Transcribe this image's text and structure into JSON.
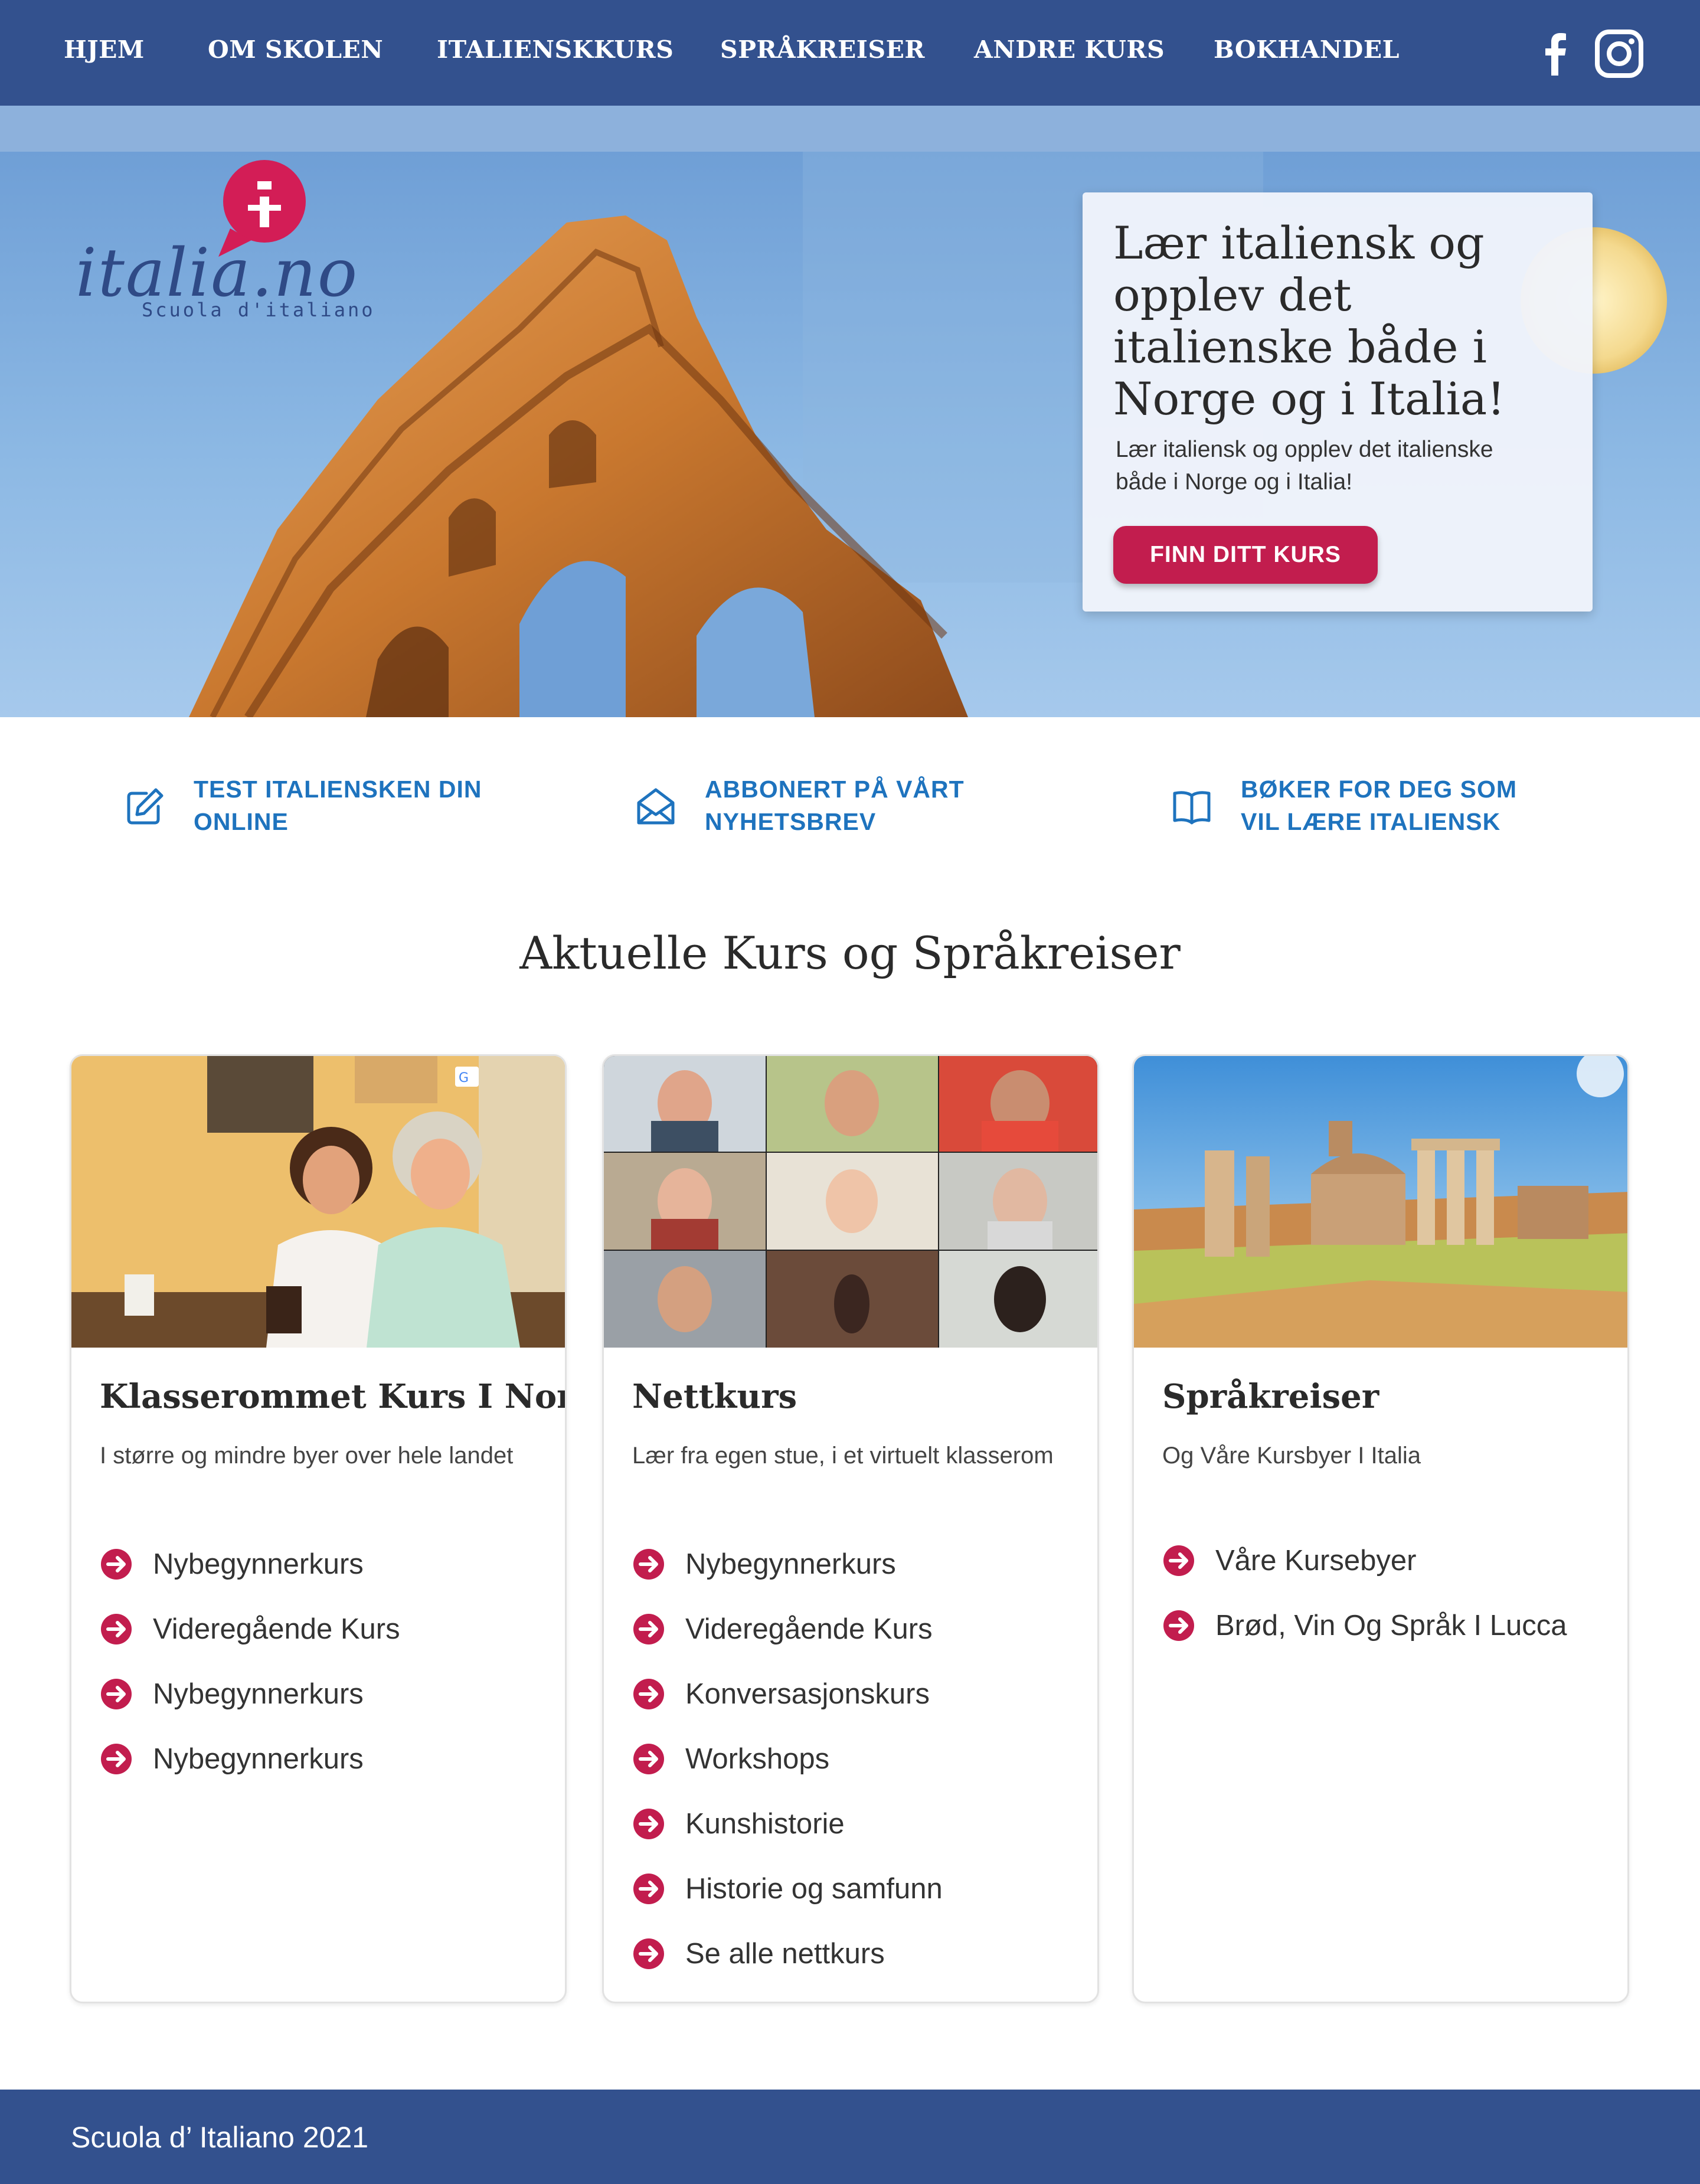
{
  "nav": {
    "items": [
      "HJEM",
      "OM SKOLEN",
      "ITALIENSKKURS",
      "SPRÅKREISER",
      "ANDRE KURS",
      "BOKHANDEL"
    ],
    "social": [
      "facebook-icon",
      "instagram-icon"
    ]
  },
  "hero": {
    "logo_text": "italia.no",
    "logo_sub": "Scuola d'italiano",
    "title": "Lær italiensk og opplev det italienske både i Norge og i Italia!",
    "subtitle": "Lær italiensk og opplev det italienske både i Norge og i Italia!",
    "cta": "FINN DITT KURS"
  },
  "quick_links": [
    {
      "icon": "edit-icon",
      "label": "TEST ITALIENSKEN DIN ONLINE"
    },
    {
      "icon": "envelope-icon",
      "label": "ABBONERT PÅ VÅRT NYHETSBREV"
    },
    {
      "icon": "book-icon",
      "label": "BØKER FOR DEG SOM VIL LÆRE ITALIENSK"
    }
  ],
  "section_title": "Aktuelle Kurs og Språkreiser",
  "cards": [
    {
      "title": "Klasserommet Kurs I Norge",
      "subtitle": "I større og mindre byer over hele landet",
      "items": [
        "Nybegynnerkurs",
        "Videregående Kurs",
        "Nybegynnerkurs",
        "Nybegynnerkurs"
      ]
    },
    {
      "title": "Nettkurs",
      "subtitle": "Lær fra egen stue, i et virtuelt klasserom",
      "items": [
        "Nybegynnerkurs",
        "Videregående Kurs",
        "Konversasjonskurs",
        "Workshops",
        "Kunshistorie",
        "Historie og samfunn",
        "Se  alle nettkurs"
      ]
    },
    {
      "title": "Språkreiser",
      "subtitle": "Og Våre Kursbyer I Italia",
      "items": [
        "Våre Kursebyer",
        "Brød, Vin Og Språk I Lucca"
      ]
    }
  ],
  "footer": {
    "text": "Scuola d’ Italiano 2021"
  },
  "colors": {
    "nav": "#33518e",
    "accent": "#c21d4e",
    "link": "#1e73be"
  }
}
